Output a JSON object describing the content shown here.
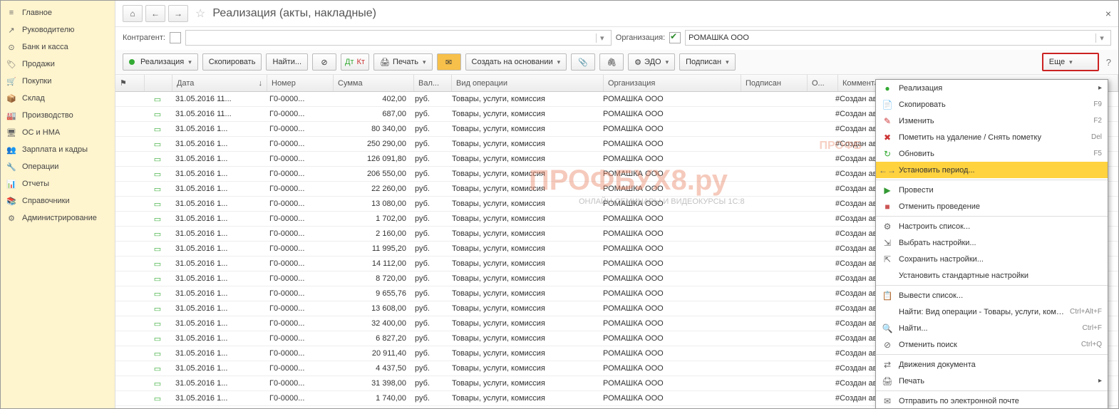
{
  "sidebar": {
    "items": [
      {
        "icon": "≡",
        "label": "Главное"
      },
      {
        "icon": "↗",
        "label": "Руководителю"
      },
      {
        "icon": "⊙",
        "label": "Банк и касса"
      },
      {
        "icon": "🏷",
        "label": "Продажи"
      },
      {
        "icon": "🛒",
        "label": "Покупки"
      },
      {
        "icon": "📦",
        "label": "Склад"
      },
      {
        "icon": "🏭",
        "label": "Производство"
      },
      {
        "icon": "🖥",
        "label": "ОС и НМА"
      },
      {
        "icon": "👥",
        "label": "Зарплата и кадры"
      },
      {
        "icon": "🔧",
        "label": "Операции"
      },
      {
        "icon": "📊",
        "label": "Отчеты"
      },
      {
        "icon": "📚",
        "label": "Справочники"
      },
      {
        "icon": "⚙",
        "label": "Администрирование"
      }
    ]
  },
  "header": {
    "title": "Реализация (акты, накладные)"
  },
  "filter": {
    "counterparty_label": "Контрагент:",
    "org_label": "Организация:",
    "org_value": "РОМАШКА ООО"
  },
  "toolbar": {
    "realization": "Реализация",
    "copy": "Скопировать",
    "find": "Найти...",
    "print": "Печать",
    "create_based": "Создать на основании",
    "edo": "ЭДО",
    "signed": "Подписан",
    "more": "Еще"
  },
  "columns": {
    "chk": "",
    "date": "Дата",
    "num": "Номер",
    "sum": "Сумма",
    "cur": "Вал...",
    "op": "Вид операции",
    "org": "Организация",
    "sign": "Подписан",
    "o": "О...",
    "comm": "Комментарий"
  },
  "rows": [
    {
      "date": "31.05.2016 11...",
      "num": "Г0-0000...",
      "sum": "402,00",
      "cur": "руб.",
      "op": "Товары, услуги, комиссия",
      "org": "РОМАШКА ООО",
      "comm": "#Создан автоматически #Реализация N..."
    },
    {
      "date": "31.05.2016 11...",
      "num": "Г0-0000...",
      "sum": "687,00",
      "cur": "руб.",
      "op": "Товары, услуги, комиссия",
      "org": "РОМАШКА ООО",
      "comm": "#Создан автоматически #Реализация N..."
    },
    {
      "date": "31.05.2016 1...",
      "num": "Г0-0000...",
      "sum": "80 340,00",
      "cur": "руб.",
      "op": "Товары, услуги, комиссия",
      "org": "РОМАШКА ООО",
      "comm": "#Создан автоматически #Реализация N..."
    },
    {
      "date": "31.05.2016 1...",
      "num": "Г0-0000...",
      "sum": "250 290,00",
      "cur": "руб.",
      "op": "Товары, услуги, комиссия",
      "org": "РОМАШКА ООО",
      "comm": "#Создан автоматически #Реализация N..."
    },
    {
      "date": "31.05.2016 1...",
      "num": "Г0-0000...",
      "sum": "126 091,80",
      "cur": "руб.",
      "op": "Товары, услуги, комиссия",
      "org": "РОМАШКА ООО",
      "comm": "#Создан автоматически #Реализация N..."
    },
    {
      "date": "31.05.2016 1...",
      "num": "Г0-0000...",
      "sum": "206 550,00",
      "cur": "руб.",
      "op": "Товары, услуги, комиссия",
      "org": "РОМАШКА ООО",
      "comm": "#Создан автоматически #Реализация N..."
    },
    {
      "date": "31.05.2016 1...",
      "num": "Г0-0000...",
      "sum": "22 260,00",
      "cur": "руб.",
      "op": "Товары, услуги, комиссия",
      "org": "РОМАШКА ООО",
      "comm": "#Создан автоматически #Реализация N..."
    },
    {
      "date": "31.05.2016 1...",
      "num": "Г0-0000...",
      "sum": "13 080,00",
      "cur": "руб.",
      "op": "Товары, услуги, комиссия",
      "org": "РОМАШКА ООО",
      "comm": "#Создан автоматически #Реализация N..."
    },
    {
      "date": "31.05.2016 1...",
      "num": "Г0-0000...",
      "sum": "1 702,00",
      "cur": "руб.",
      "op": "Товары, услуги, комиссия",
      "org": "РОМАШКА ООО",
      "comm": "#Создан автоматически #Реализация N..."
    },
    {
      "date": "31.05.2016 1...",
      "num": "Г0-0000...",
      "sum": "2 160,00",
      "cur": "руб.",
      "op": "Товары, услуги, комиссия",
      "org": "РОМАШКА ООО",
      "comm": "#Создан автоматически #Реализация N..."
    },
    {
      "date": "31.05.2016 1...",
      "num": "Г0-0000...",
      "sum": "11 995,20",
      "cur": "руб.",
      "op": "Товары, услуги, комиссия",
      "org": "РОМАШКА ООО",
      "comm": "#Создан автоматически #Реализация N..."
    },
    {
      "date": "31.05.2016 1...",
      "num": "Г0-0000...",
      "sum": "14 112,00",
      "cur": "руб.",
      "op": "Товары, услуги, комиссия",
      "org": "РОМАШКА ООО",
      "comm": "#Создан автоматически #Реализация N..."
    },
    {
      "date": "31.05.2016 1...",
      "num": "Г0-0000...",
      "sum": "8 720,00",
      "cur": "руб.",
      "op": "Товары, услуги, комиссия",
      "org": "РОМАШКА ООО",
      "comm": "#Создан автоматически #Реализация N..."
    },
    {
      "date": "31.05.2016 1...",
      "num": "Г0-0000...",
      "sum": "9 655,76",
      "cur": "руб.",
      "op": "Товары, услуги, комиссия",
      "org": "РОМАШКА ООО",
      "comm": "#Создан автоматически #Реализация N..."
    },
    {
      "date": "31.05.2016 1...",
      "num": "Г0-0000...",
      "sum": "13 608,00",
      "cur": "руб.",
      "op": "Товары, услуги, комиссия",
      "org": "РОМАШКА ООО",
      "comm": "#Создан автоматически #Реализация N..."
    },
    {
      "date": "31.05.2016 1...",
      "num": "Г0-0000...",
      "sum": "32 400,00",
      "cur": "руб.",
      "op": "Товары, услуги, комиссия",
      "org": "РОМАШКА ООО",
      "comm": "#Создан автоматически #Реализация N..."
    },
    {
      "date": "31.05.2016 1...",
      "num": "Г0-0000...",
      "sum": "6 827,20",
      "cur": "руб.",
      "op": "Товары, услуги, комиссия",
      "org": "РОМАШКА ООО",
      "comm": "#Создан автоматически #Реализация N..."
    },
    {
      "date": "31.05.2016 1...",
      "num": "Г0-0000...",
      "sum": "20 911,40",
      "cur": "руб.",
      "op": "Товары, услуги, комиссия",
      "org": "РОМАШКА ООО",
      "comm": "#Создан автоматически #Реализация N..."
    },
    {
      "date": "31.05.2016 1...",
      "num": "Г0-0000...",
      "sum": "4 437,50",
      "cur": "руб.",
      "op": "Товары, услуги, комиссия",
      "org": "РОМАШКА ООО",
      "comm": "#Создан автоматически #Реализация N..."
    },
    {
      "date": "31.05.2016 1...",
      "num": "Г0-0000...",
      "sum": "31 398,00",
      "cur": "руб.",
      "op": "Товары, услуги, комиссия",
      "org": "РОМАШКА ООО",
      "comm": "#Создан автоматически #Реализация N..."
    },
    {
      "date": "31.05.2016 1...",
      "num": "Г0-0000...",
      "sum": "1 740,00",
      "cur": "руб.",
      "op": "Товары, услуги, комиссия",
      "org": "РОМАШКА ООО",
      "comm": "#Создан автоматически #Реализация N..."
    }
  ],
  "context_menu": {
    "items": [
      {
        "icon": "●",
        "color": "#3a3",
        "label": "Реализация",
        "arrow": true
      },
      {
        "icon": "📄",
        "label": "Скопировать",
        "shortcut": "F9"
      },
      {
        "icon": "✎",
        "color": "#c33",
        "label": "Изменить",
        "shortcut": "F2"
      },
      {
        "icon": "✖",
        "color": "#c33",
        "label": "Пометить на удаление / Снять пометку",
        "shortcut": "Del"
      },
      {
        "icon": "↻",
        "color": "#3a3",
        "label": "Обновить",
        "shortcut": "F5"
      },
      {
        "icon": "←→",
        "label": "Установить период...",
        "highlight": true
      },
      {
        "sep": true
      },
      {
        "icon": "▶",
        "color": "#393",
        "label": "Провести"
      },
      {
        "icon": "■",
        "color": "#c55",
        "label": "Отменить проведение"
      },
      {
        "sep": true
      },
      {
        "icon": "⚙",
        "label": "Настроить список..."
      },
      {
        "icon": "⇲",
        "label": "Выбрать настройки..."
      },
      {
        "icon": "⇱",
        "label": "Сохранить настройки..."
      },
      {
        "icon": "",
        "label": "Установить стандартные настройки"
      },
      {
        "sep": true
      },
      {
        "icon": "📋",
        "label": "Вывести список..."
      },
      {
        "icon": "",
        "label": "Найти: Вид операции - Товары, услуги, коми...",
        "shortcut": "Ctrl+Alt+F"
      },
      {
        "icon": "🔍",
        "label": "Найти...",
        "shortcut": "Ctrl+F"
      },
      {
        "icon": "⊘",
        "label": "Отменить поиск",
        "shortcut": "Ctrl+Q"
      },
      {
        "sep": true
      },
      {
        "icon": "⇄",
        "label": "Движения документа"
      },
      {
        "icon": "🖨",
        "label": "Печать",
        "arrow": true
      },
      {
        "sep": true
      },
      {
        "icon": "✉",
        "label": "Отправить по электронной почте"
      }
    ]
  },
  "watermark": {
    "main": "ПРОФБУХ8.ру",
    "sub": "ОНЛАЙН-СЕМИНАРЫ И ВИДЕОКУРСЫ 1С:8",
    "logo": "ПРОФБ"
  }
}
